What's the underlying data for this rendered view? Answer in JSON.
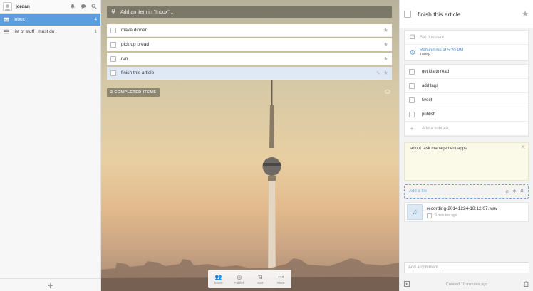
{
  "sidebar": {
    "username": "jordan",
    "lists": [
      {
        "label": "Inbox",
        "count": "4",
        "icon": "inbox-icon"
      },
      {
        "label": "list of stuff i must do",
        "count": "1",
        "icon": "list-icon"
      }
    ],
    "add_label": "+"
  },
  "main": {
    "add_placeholder": "Add an item in \"Inbox\"...",
    "tasks": [
      {
        "title": "make dinner"
      },
      {
        "title": "pick up bread"
      },
      {
        "title": "run"
      },
      {
        "title": "finish this article"
      }
    ],
    "completed_label": "2 COMPLETED ITEMS",
    "toolbar": [
      {
        "label": "Share",
        "icon": "share-icon"
      },
      {
        "label": "Publish",
        "icon": "publish-icon"
      },
      {
        "label": "Sort",
        "icon": "sort-icon"
      },
      {
        "label": "More",
        "icon": "more-icon"
      }
    ]
  },
  "detail": {
    "title": "finish this article",
    "due_placeholder": "Set due date",
    "reminder": "Remind me at 5:20 PM",
    "reminder_day": "Today",
    "subtasks": [
      "get kia to read",
      "add tags",
      "tweet",
      "publish"
    ],
    "add_subtask": "Add a subtask",
    "note": "about task management apps",
    "add_file": "Add a file",
    "file_name": "recording-20141224-18:12:07.wav",
    "file_time": "9 minutes ago",
    "comment_placeholder": "Add a comment...",
    "created": "Created 10 minutes ago"
  },
  "colors": {
    "accent": "#5b9ee0",
    "selected_task": "#dfe9f5",
    "note_bg": "#fbf9e8",
    "link": "#4a90d9"
  }
}
